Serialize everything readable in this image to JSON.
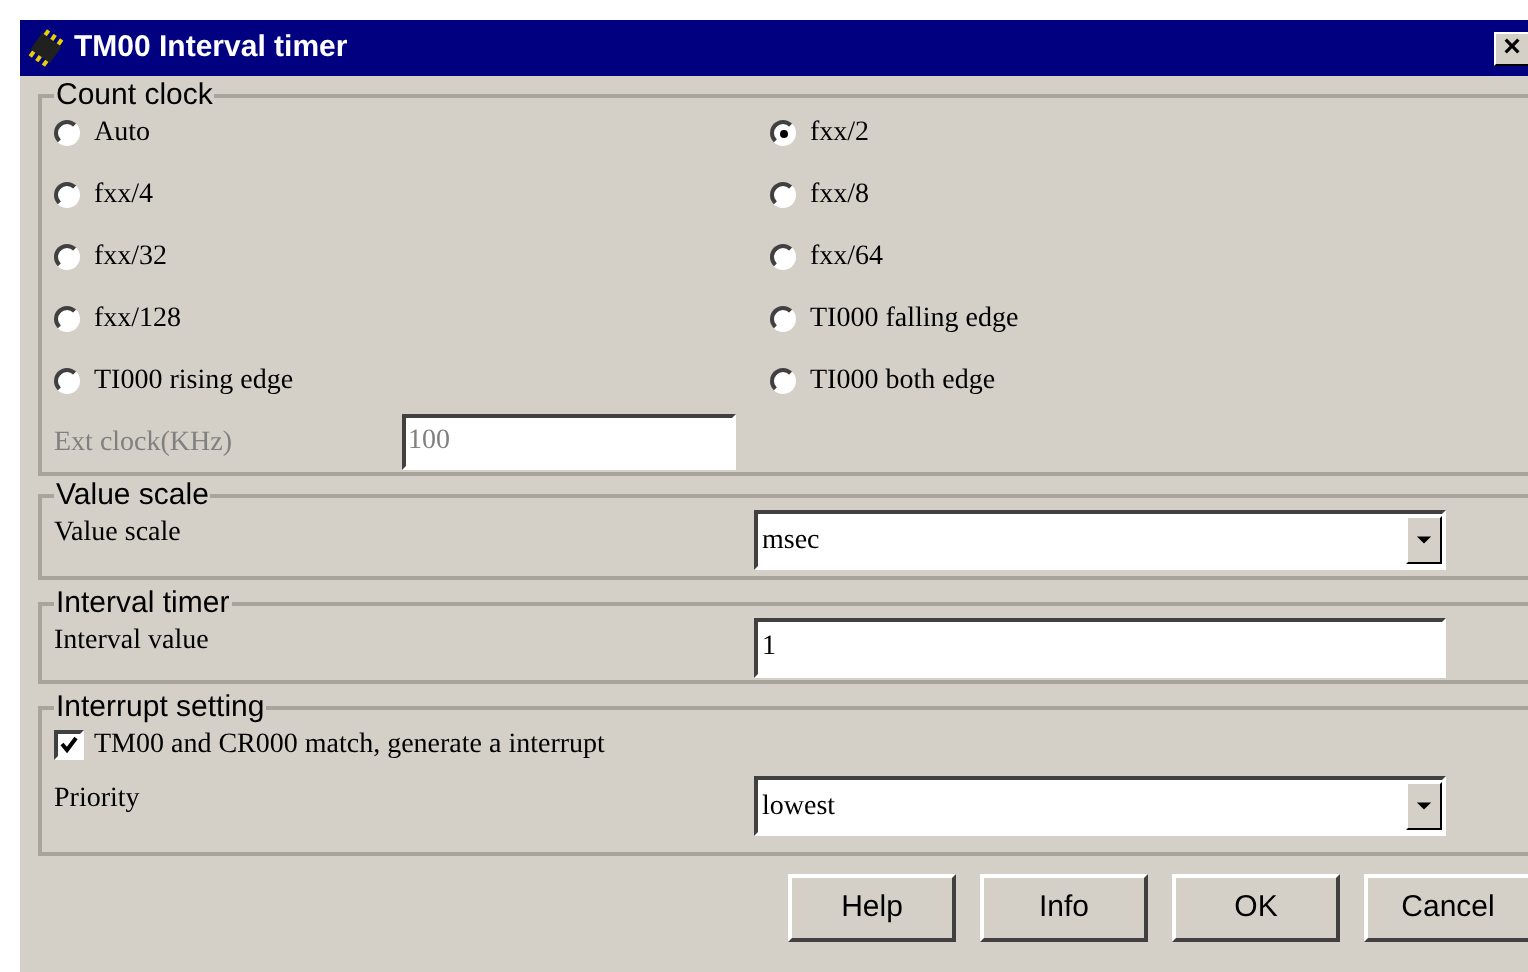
{
  "window": {
    "title": "TM00 Interval timer",
    "close": "×"
  },
  "count_clock": {
    "title": "Count clock",
    "options": [
      {
        "label": "Auto",
        "selected": false
      },
      {
        "label": "fxx/2",
        "selected": true
      },
      {
        "label": "fxx/4",
        "selected": false
      },
      {
        "label": "fxx/8",
        "selected": false
      },
      {
        "label": "fxx/32",
        "selected": false
      },
      {
        "label": "fxx/64",
        "selected": false
      },
      {
        "label": "fxx/128",
        "selected": false
      },
      {
        "label": "TI000 falling edge",
        "selected": false
      },
      {
        "label": "TI000 rising edge",
        "selected": false
      },
      {
        "label": "TI000 both edge",
        "selected": false
      }
    ],
    "ext_clock": {
      "label": "Ext clock(KHz)",
      "value": "100",
      "disabled": true
    }
  },
  "value_scale": {
    "title": "Value scale",
    "label": "Value scale",
    "value": "msec"
  },
  "interval_timer": {
    "title": "Interval timer",
    "label": "Interval value",
    "value": "1"
  },
  "interrupt_setting": {
    "title": "Interrupt setting",
    "checkbox": {
      "label": "TM00 and CR000 match, generate a interrupt",
      "checked": true
    },
    "priority_label": "Priority",
    "priority": "lowest"
  },
  "buttons": [
    "Help",
    "Info",
    "OK",
    "Cancel"
  ]
}
